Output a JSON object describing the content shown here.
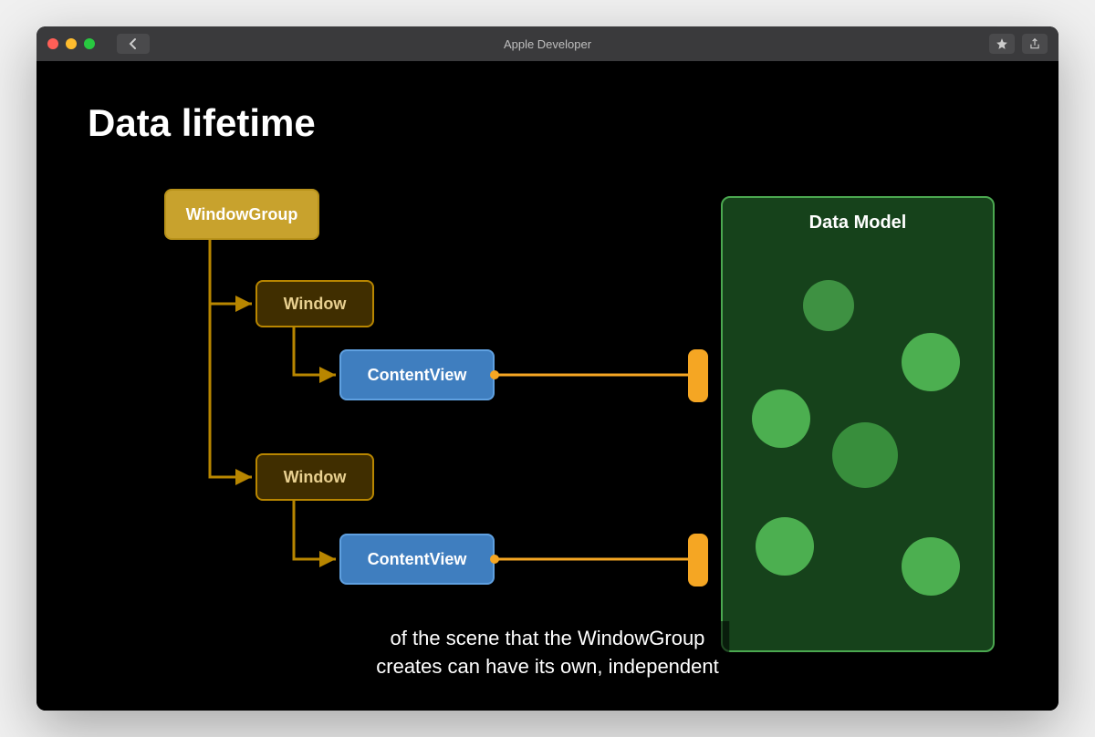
{
  "window": {
    "title": "Apple Developer"
  },
  "slide": {
    "title": "Data lifetime",
    "nodes": {
      "windowGroup": "WindowGroup",
      "window1": "Window",
      "window2": "Window",
      "contentView1": "ContentView",
      "contentView2": "ContentView",
      "dataModel": "Data Model"
    },
    "caption_line1": "of the scene that the WindowGroup",
    "caption_line2": "creates can have its own, independent"
  },
  "colors": {
    "windowGroup": "#c8a22d",
    "windowNode": "#b88600",
    "contentView": "#3f7ebf",
    "dataModel": "#4ba850",
    "connector": "#f5a623"
  }
}
